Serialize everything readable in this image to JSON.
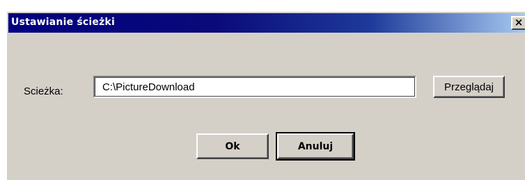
{
  "window": {
    "title": "Ustawianie ścieżki",
    "close_glyph": "×"
  },
  "path_field": {
    "label": "Scieżka:",
    "value": "C:\\PictureDownload"
  },
  "buttons": {
    "browse_label": "Przeglądaj",
    "ok_label": "Ok",
    "cancel_label": "Anuluj"
  },
  "colors": {
    "titlebar_start": "#000080",
    "titlebar_end": "#a6caf0",
    "dialog_bg": "#d4d0c8"
  },
  "icons": {
    "close": "close-icon"
  }
}
